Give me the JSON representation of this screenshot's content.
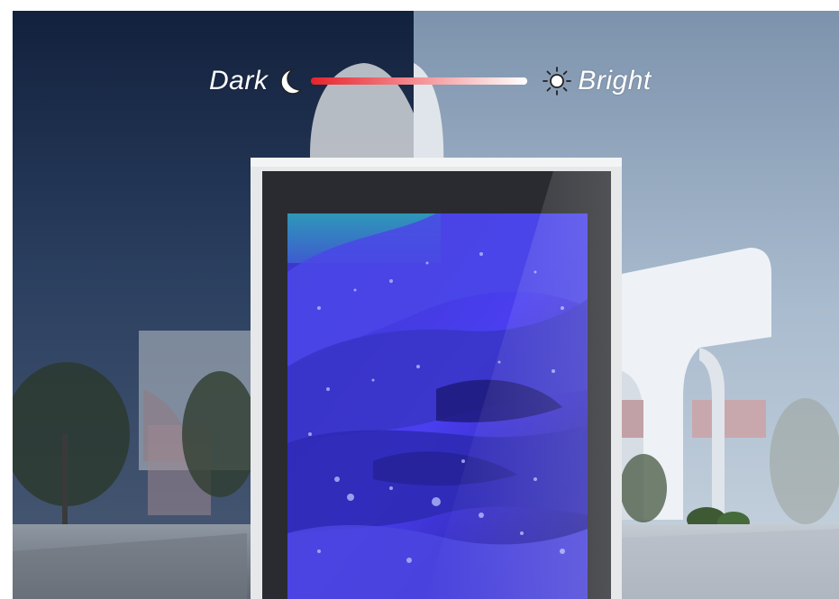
{
  "brightness_control": {
    "dark_label": "Dark",
    "bright_label": "Bright",
    "icons": {
      "left": "moon-icon",
      "right": "sun-icon"
    },
    "track_colors": {
      "start": "#e8232b",
      "end": "#ffffff"
    },
    "level": 1.0
  },
  "colors": {
    "dark_sky": "#1b2d4c",
    "bright_sky": "#9fb3c9",
    "building_white": "#eef2f6",
    "building_pink": "#c9a8ad",
    "screen_bezel": "#2a2b30",
    "screen_frame": "#e6e8ea",
    "rose_blue": "#3b2fd9"
  }
}
